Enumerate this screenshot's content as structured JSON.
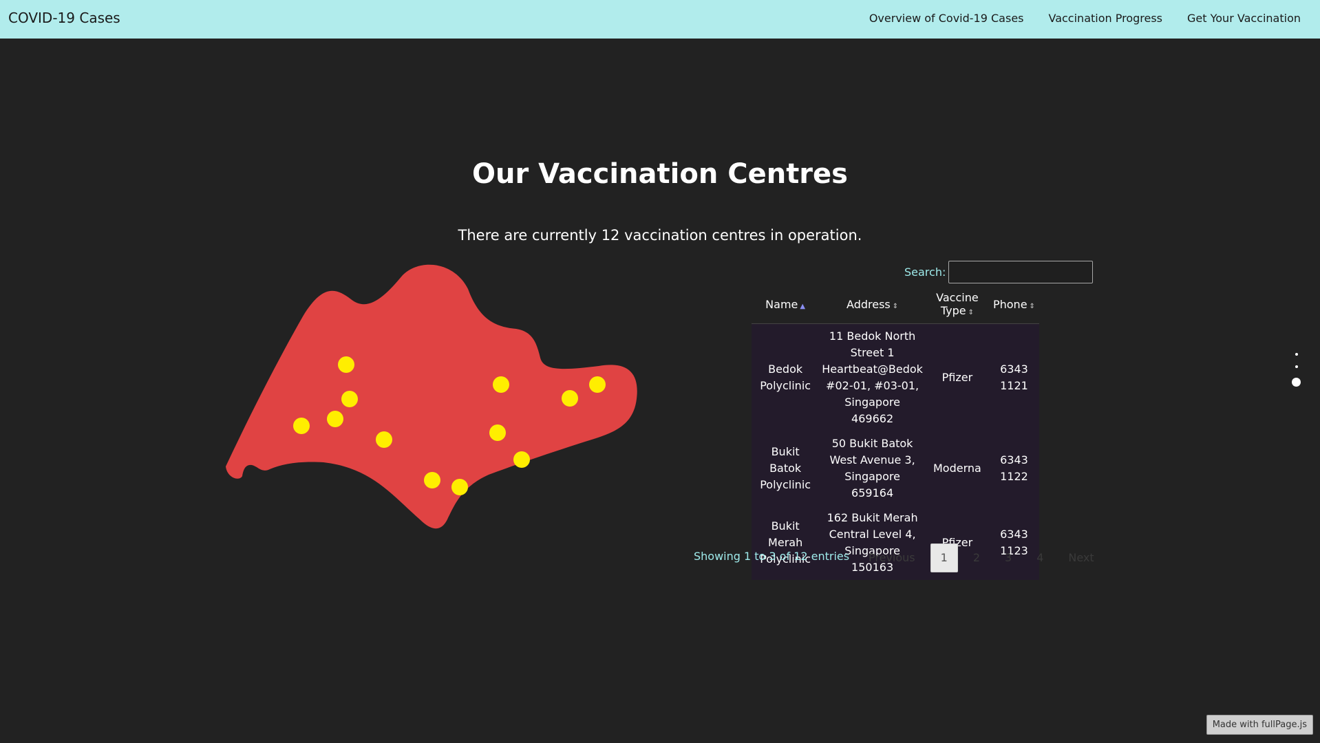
{
  "header": {
    "brand": "COVID-19 Cases",
    "nav": [
      {
        "label": "Overview of Covid-19 Cases"
      },
      {
        "label": "Vaccination Progress"
      },
      {
        "label": "Get Your Vaccination"
      }
    ]
  },
  "section": {
    "title": "Our Vaccination Centres",
    "subtitle": "There are currently 12 vaccination centres in operation."
  },
  "search": {
    "label": "Search:",
    "value": ""
  },
  "table": {
    "columns": [
      "Name",
      "Address",
      "Vaccine Type",
      "Phone"
    ],
    "rows": [
      {
        "name": "Bedok Polyclinic",
        "address": "11 Bedok North Street 1 Heartbeat@Bedok #02-01, #03-01, Singapore 469662",
        "vaccine": "Pfizer",
        "phone": "6343 1121"
      },
      {
        "name": "Bukit Batok Polyclinic",
        "address": "50 Bukit Batok West Avenue 3, Singapore 659164",
        "vaccine": "Moderna",
        "phone": "6343 1122"
      },
      {
        "name": "Bukit Merah Polyclinic",
        "address": "162 Bukit Merah Central Level 4, Singapore 150163",
        "vaccine": "Pfizer",
        "phone": "6343 1123"
      }
    ]
  },
  "pagination": {
    "info": "Showing 1 to 3 of 12 entries",
    "previous": "Previous",
    "pages": [
      "1",
      "2",
      "3",
      "4"
    ],
    "current": "1",
    "next": "Next"
  },
  "section_nav": {
    "count": 3,
    "active_index": 2
  },
  "credit": "Made with fullPage.js",
  "colors": {
    "header_bg": "#b1ecec",
    "page_bg": "#222222",
    "map_fill": "#e04343",
    "marker": "#ffee00",
    "accent_text": "#9eeaea"
  }
}
